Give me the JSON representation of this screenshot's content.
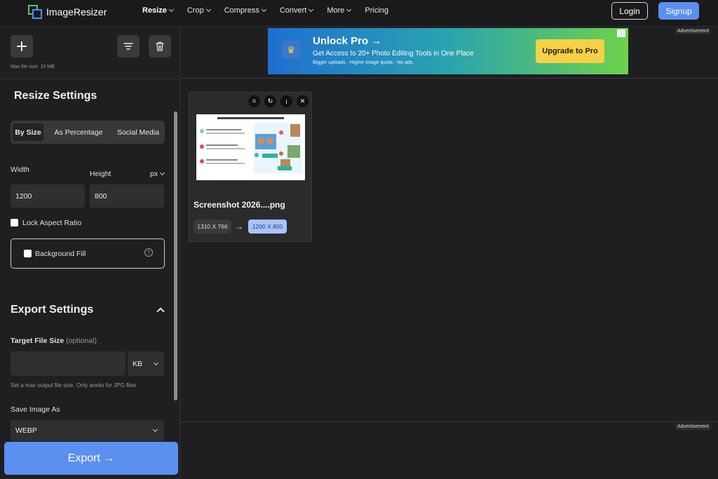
{
  "app": {
    "name": "ImageResizer"
  },
  "nav": {
    "items": [
      {
        "label": "Resize",
        "dropdown": true,
        "active": true
      },
      {
        "label": "Crop",
        "dropdown": true
      },
      {
        "label": "Compress",
        "dropdown": true
      },
      {
        "label": "Convert",
        "dropdown": true
      },
      {
        "label": "More",
        "dropdown": true
      },
      {
        "label": "Pricing",
        "dropdown": false
      }
    ],
    "login": "Login",
    "signup": "Signup"
  },
  "toolbar": {
    "add_icon": "plus-icon",
    "filter_icon": "filter-icon",
    "delete_icon": "trash-icon",
    "max_file_size": "Max file size: 10 MB"
  },
  "resize": {
    "title": "Resize Settings",
    "tabs": [
      {
        "label": "By Size",
        "active": true
      },
      {
        "label": "As Percentage"
      },
      {
        "label": "Social Media"
      }
    ],
    "width_label": "Width",
    "height_label": "Height",
    "unit": "px",
    "width_value": "1200",
    "height_value": "800",
    "lock_aspect": "Lock Aspect Ratio",
    "background_fill": "Background Fill"
  },
  "export": {
    "title": "Export Settings",
    "target_size_label": "Target File Size",
    "target_size_optional": "(optional)",
    "target_size_value": "",
    "target_size_unit": "KB",
    "hint": "Set a max output file size. Only works for JPG files",
    "save_as_label": "Save Image As",
    "format": "WEBP",
    "button": "Export →"
  },
  "ad": {
    "label": "Advertisement",
    "title": "Unlock Pro →",
    "subtitle": "Get Access to 20+ Photo Editing Tools in One Place",
    "small": "Bigger uploads · Higher image quota · No ads.",
    "cta": "Upgrade to Pro"
  },
  "file": {
    "name": "Screenshot 2026....png",
    "original_dims": "1310 X 766",
    "new_dims": "1200 X 800"
  },
  "colors": {
    "accent": "#5b8ff0",
    "background": "#1f1f21",
    "cta_yellow": "#f6d145"
  }
}
